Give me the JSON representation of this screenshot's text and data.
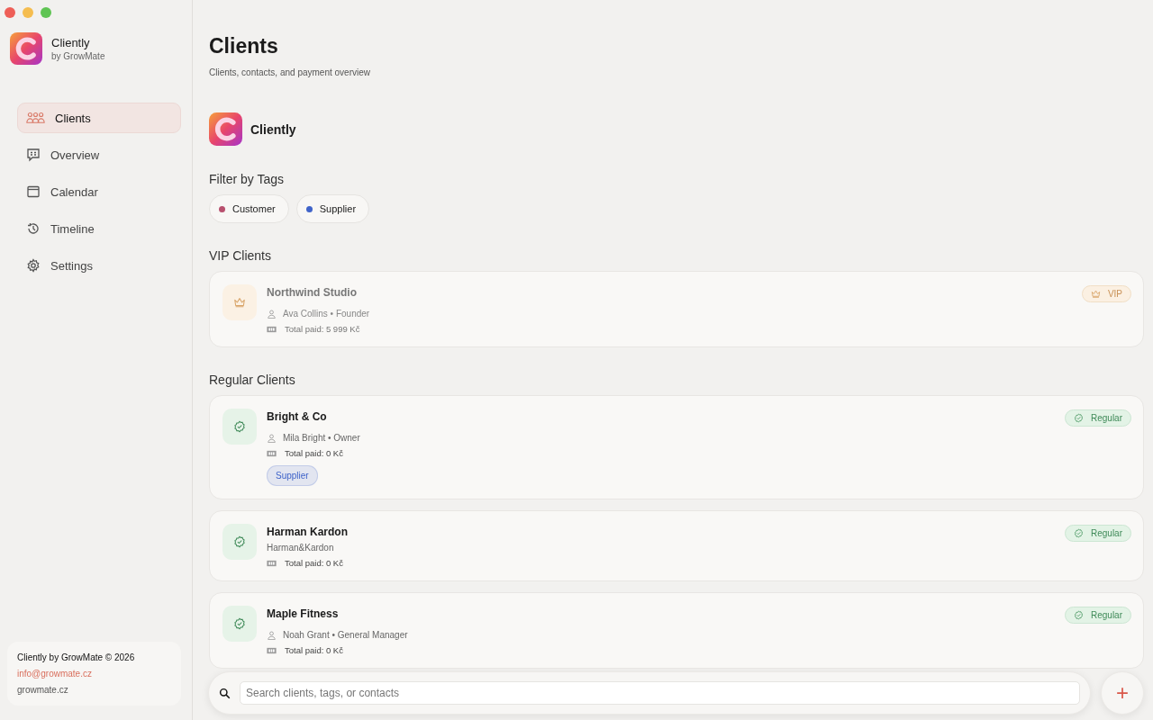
{
  "app": {
    "name": "Cliently",
    "byline": "by GrowMate"
  },
  "sidebar": {
    "items": [
      {
        "label": "Clients",
        "selected": true
      },
      {
        "label": "Overview",
        "selected": false
      },
      {
        "label": "Calendar",
        "selected": false
      },
      {
        "label": "Timeline",
        "selected": false
      },
      {
        "label": "Settings",
        "selected": false
      }
    ],
    "footer": {
      "copyright": "Cliently by GrowMate © 2026",
      "email": "info@growmate.cz",
      "website": "growmate.cz"
    }
  },
  "page": {
    "title": "Clients",
    "subtitle": "Clients, contacts, and payment overview",
    "brand": "Cliently"
  },
  "filter": {
    "heading": "Filter by Tags",
    "tags": [
      {
        "label": "Customer",
        "color": "#b8506e"
      },
      {
        "label": "Supplier",
        "color": "#3f63c9"
      }
    ]
  },
  "sections": [
    {
      "heading": "VIP Clients",
      "clients": [
        {
          "kind": "vip",
          "name": "Northwind Studio",
          "badge": "VIP",
          "contact": "Ava Collins • Founder",
          "total": "Total paid: 5 999 Kč"
        }
      ]
    },
    {
      "heading": "Regular Clients",
      "clients": [
        {
          "kind": "regular",
          "name": "Bright & Co",
          "badge": "Regular",
          "contact": "Mila Bright • Owner",
          "total": "Total paid: 0 Kč",
          "tags": [
            {
              "label": "Supplier",
              "color": "#3f63c9"
            }
          ]
        },
        {
          "kind": "regular",
          "name": "Harman  Kardon",
          "badge": "Regular",
          "company": "Harman&Kardon",
          "total": "Total paid: 0 Kč"
        },
        {
          "kind": "regular",
          "name": "Maple Fitness",
          "badge": "Regular",
          "contact": "Noah Grant • General Manager",
          "total": "Total paid: 0 Kč"
        }
      ]
    }
  ],
  "search": {
    "placeholder": "Search clients, tags, or contacts"
  },
  "add_button": {
    "label": "+"
  }
}
